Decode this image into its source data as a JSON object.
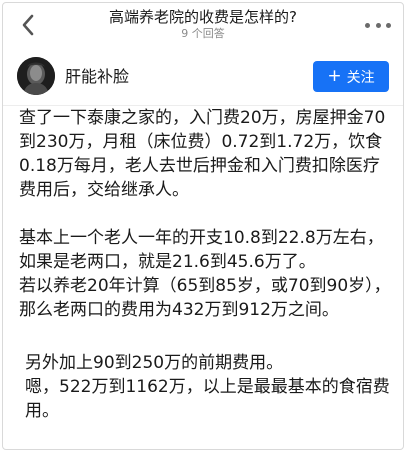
{
  "header": {
    "title": "高端养老院的收费是怎样的?",
    "answer_count": "9 个回答",
    "back_icon": "chevron-left-icon",
    "more_icon": "more-dots-icon"
  },
  "author": {
    "name": "肝能补脸",
    "follow_label": "关注",
    "follow_color": "#1772f6"
  },
  "paragraphs": [
    "查了一下泰康之家的，入门费20万，房屋押金70到230万，月租（床位费）0.72到1.72万，饮食0.18万每月，老人去世后押金和入门费扣除医疗费用后，交给继承人。",
    "基本上一个老人一年的开支10.8到22.8万左右，如果是老两口，就是21.6到45.6万了。",
    "若以养老20年计算（65到85岁，或70到90岁），那么老两口的费用为432万到912万之间。",
    "另外加上90到250万的前期费用。",
    "嗯，522万到1162万，以上是最最基本的食宿费用。"
  ]
}
